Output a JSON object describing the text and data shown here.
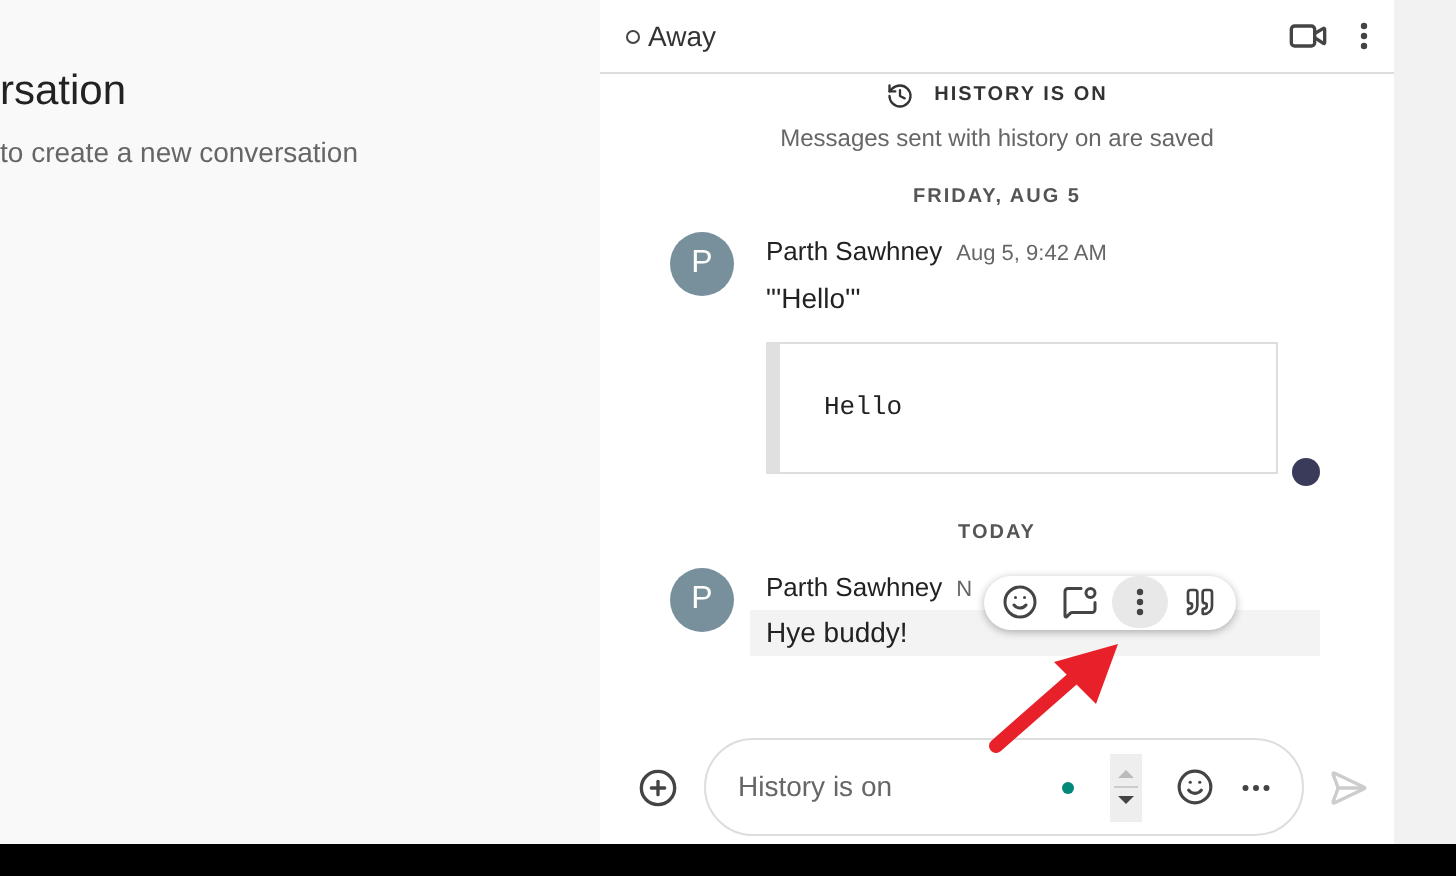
{
  "background": {
    "title": "rsation",
    "subtitle": "to create a new conversation"
  },
  "chat": {
    "status": "Away",
    "history": {
      "label": "HISTORY IS ON",
      "note": "Messages sent with history on are saved"
    },
    "sections": [
      {
        "date": "FRIDAY, AUG 5",
        "messages": [
          {
            "initial": "P",
            "sender": "Parth Sawhney",
            "time": "Aug 5, 9:42 AM",
            "text": "\"'Hello'\"",
            "code": "Hello",
            "highlighted": false,
            "read_receipt": true
          }
        ]
      },
      {
        "date": "TODAY",
        "messages": [
          {
            "initial": "P",
            "sender": "Parth Sawhney",
            "time": "N",
            "text": "Hye buddy!",
            "highlighted": true,
            "actions": [
              {
                "kind": "emoji",
                "selected": false
              },
              {
                "kind": "reply",
                "selected": false
              },
              {
                "kind": "more",
                "selected": true
              },
              {
                "kind": "quote",
                "selected": false
              }
            ]
          }
        ]
      }
    ],
    "composer": {
      "placeholder": "History is on"
    }
  }
}
